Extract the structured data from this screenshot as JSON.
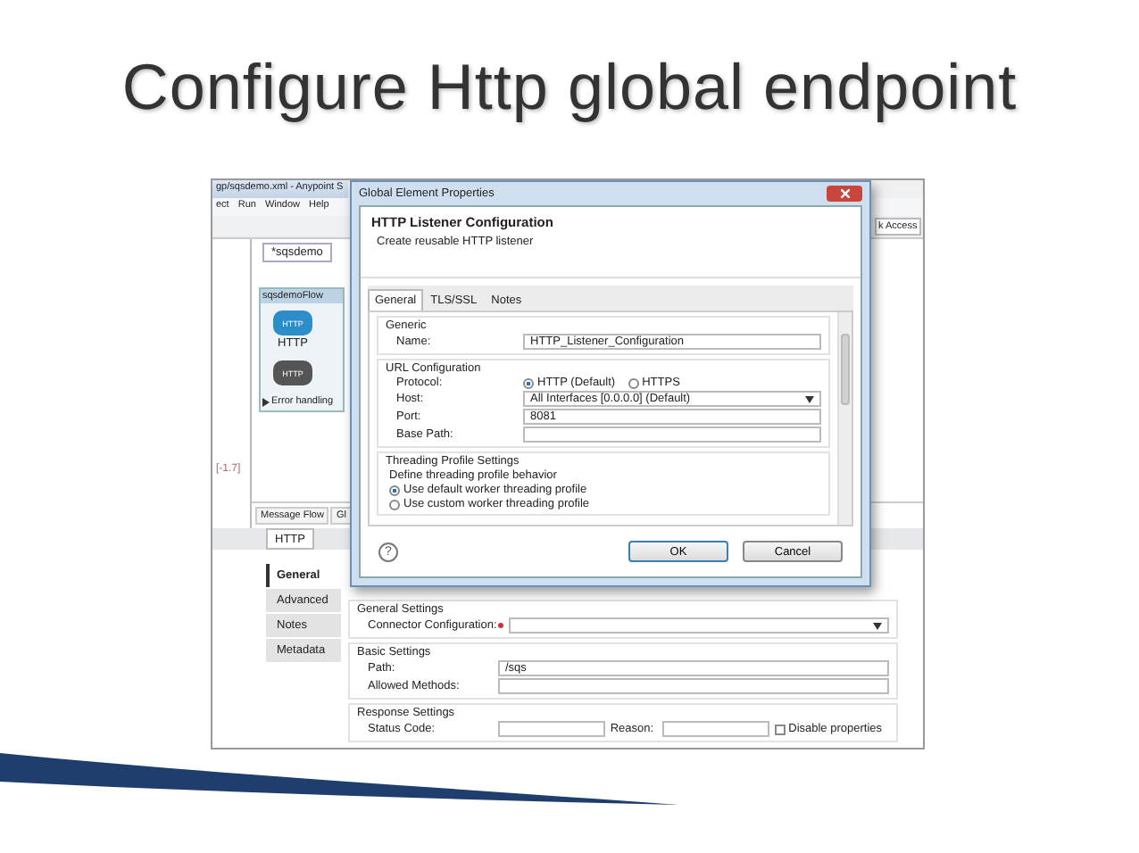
{
  "slide": {
    "title": "Configure Http global endpoint"
  },
  "ide": {
    "window_title": "gp/sqsdemo.xml - Anypoint S",
    "menu": [
      "ect",
      "Run",
      "Window",
      "Help"
    ],
    "quick_access": "k Access",
    "left_panel_text": "[-1.7]",
    "editor_tab": "*sqsdemo",
    "flow": {
      "name": "sqsdemoFlow",
      "nodes": [
        {
          "badge": "HTTP",
          "label": "HTTP"
        },
        {
          "badge": "HTTP"
        }
      ],
      "error_handling": "Error handling"
    },
    "editor_bottom_tabs": [
      "Message Flow",
      "Gl"
    ],
    "properties": {
      "tab": "HTTP",
      "side_tabs": [
        {
          "label": "General",
          "selected": true
        },
        {
          "label": "Advanced",
          "selected": false
        },
        {
          "label": "Notes",
          "selected": false
        },
        {
          "label": "Metadata",
          "selected": false
        }
      ],
      "sections": [
        {
          "title": "General Settings",
          "rows": [
            {
              "kind": "select",
              "label": "Connector Configuration:",
              "required": true
            }
          ]
        },
        {
          "title": "Basic Settings",
          "rows": [
            {
              "kind": "text",
              "label": "Path:",
              "value": "/sqs"
            },
            {
              "kind": "text",
              "label": "Allowed Methods:"
            }
          ]
        },
        {
          "title": "Response Settings",
          "rows": [
            {
              "kind": "pair",
              "label": "Status Code:",
              "label2": "Reason:",
              "check": {
                "label": "Disable properties",
                "checked": false
              }
            }
          ]
        }
      ]
    }
  },
  "dialog": {
    "title": "Global Element Properties",
    "heading": "HTTP Listener Configuration",
    "subtitle": "Create reusable HTTP listener",
    "tabs": [
      {
        "label": "General",
        "selected": true
      },
      {
        "label": "TLS/SSL",
        "selected": false
      },
      {
        "label": "Notes",
        "selected": false
      }
    ],
    "groups": [
      {
        "title": "Generic",
        "rows": [
          {
            "kind": "text",
            "label": "Name:",
            "value": "HTTP_Listener_Configuration"
          }
        ]
      },
      {
        "title": "URL Configuration",
        "rows": [
          {
            "kind": "radio",
            "label": "Protocol:",
            "options": [
              {
                "label": "HTTP (Default)",
                "selected": true
              },
              {
                "label": "HTTPS",
                "selected": false
              }
            ]
          },
          {
            "kind": "select",
            "label": "Host:",
            "value": "All Interfaces [0.0.0.0] (Default)"
          },
          {
            "kind": "text",
            "label": "Port:",
            "value": "8081"
          },
          {
            "kind": "text",
            "label": "Base Path:"
          }
        ]
      },
      {
        "title": "Threading Profile Settings",
        "description": "Define threading profile behavior",
        "options": [
          {
            "label": "Use default worker threading profile",
            "selected": true
          },
          {
            "label": "Use custom worker threading profile",
            "selected": false
          }
        ]
      }
    ],
    "help": "?",
    "buttons": [
      {
        "label": "OK",
        "kind": "primary"
      },
      {
        "label": "Cancel",
        "kind": "secondary"
      }
    ]
  }
}
